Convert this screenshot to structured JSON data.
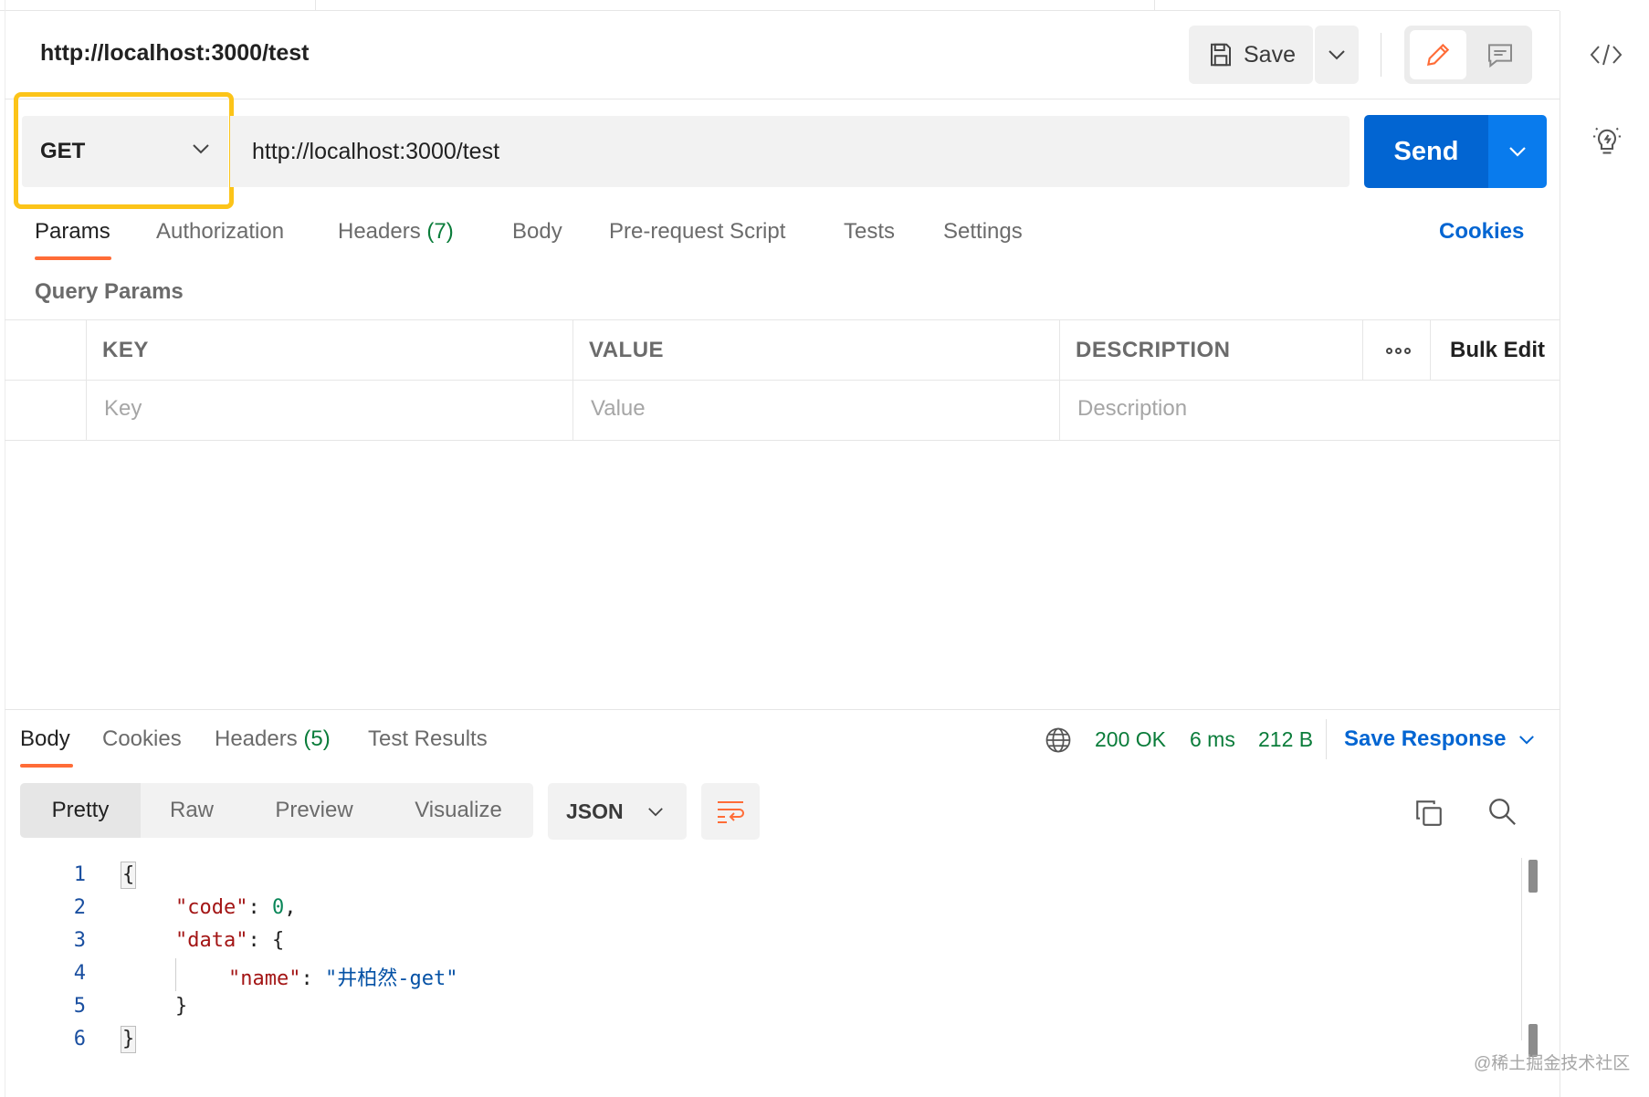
{
  "request": {
    "title": "http://localhost:3000/test",
    "method": "GET",
    "url": "http://localhost:3000/test",
    "save_label": "Save",
    "send_label": "Send"
  },
  "request_tabs": [
    {
      "label": "Params"
    },
    {
      "label": "Authorization"
    },
    {
      "label": "Headers",
      "count": "(7)"
    },
    {
      "label": "Body"
    },
    {
      "label": "Pre-request Script"
    },
    {
      "label": "Tests"
    },
    {
      "label": "Settings"
    }
  ],
  "cookies_link": "Cookies",
  "query_params": {
    "section_label": "Query Params",
    "headers": {
      "key": "KEY",
      "value": "VALUE",
      "description": "DESCRIPTION"
    },
    "bulk_edit_label": "Bulk Edit",
    "placeholders": {
      "key": "Key",
      "value": "Value",
      "description": "Description"
    }
  },
  "response": {
    "tabs": [
      {
        "label": "Body"
      },
      {
        "label": "Cookies"
      },
      {
        "label": "Headers",
        "count": "(5)"
      },
      {
        "label": "Test Results"
      }
    ],
    "status": "200 OK",
    "time": "6 ms",
    "size": "212 B",
    "save_response_label": "Save Response",
    "view_modes": [
      "Pretty",
      "Raw",
      "Preview",
      "Visualize"
    ],
    "format": "JSON",
    "body_lines": {
      "l1": "{",
      "code_key": "\"code\"",
      "code_val": "0",
      "data_key": "\"data\"",
      "name_key": "\"name\"",
      "name_val": "\"井柏然-get\"",
      "l5": "}",
      "l6": "}"
    },
    "line_numbers": [
      "1",
      "2",
      "3",
      "4",
      "5",
      "6"
    ]
  },
  "watermark": "@稀土掘金技术社区",
  "colors": {
    "accent_orange": "#ff6c37",
    "send_blue": "#0265d2",
    "highlight_yellow": "#fcc419",
    "status_green": "#0a7c3a"
  }
}
